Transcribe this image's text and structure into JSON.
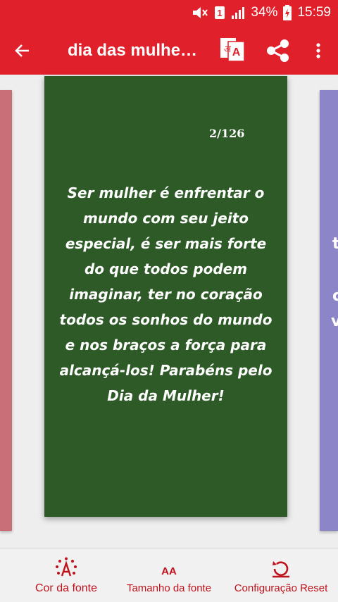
{
  "status_bar": {
    "battery_percent": "34%",
    "time": "15:59",
    "sim_badge": "1",
    "icons": [
      "mute-icon",
      "sim-icon",
      "signal-icon",
      "battery-charging-icon"
    ]
  },
  "toolbar": {
    "title": "dia das mulhe…",
    "icons": [
      "back-arrow-icon",
      "translate-icon",
      "share-icon",
      "more-vert-icon"
    ],
    "translate_glyphs": {
      "left": "अ",
      "right": "A"
    }
  },
  "card": {
    "counter": "2/126",
    "quote_lines": [
      "Ser mulher é enfrentar o",
      "mundo com seu jeito",
      "especial, é ser mais forte",
      "do que todos podem",
      "imaginar, ter no coração",
      "todos os sonhos do mundo",
      "e nos braços a força para",
      "alcançá-los! Parabéns pelo",
      "Dia da Mulher!"
    ],
    "background": "#2d5a27"
  },
  "side_cards": {
    "left_color": "#c96f78",
    "right_color": "#8c86c8",
    "right_visible_glyphs": [
      "t",
      "c",
      "v"
    ]
  },
  "bottom_bar": {
    "font_color_label": "Cor da fonte",
    "font_size_label": "Tamanho da fonte",
    "reset_label": "Configuração Reset",
    "font_size_icon_text": "AA",
    "icons": [
      "font-color-icon",
      "font-size-icon",
      "reset-icon"
    ]
  },
  "colors": {
    "accent": "#e0202b",
    "label_red": "#c0121c"
  }
}
